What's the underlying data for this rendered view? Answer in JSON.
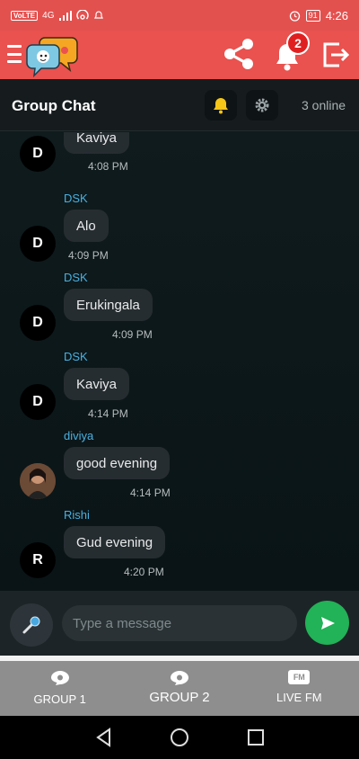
{
  "status_bar": {
    "volte": "VoLTE",
    "network": "4G",
    "battery": "91",
    "time": "4:26"
  },
  "header": {
    "notification_count": "2",
    "brand_color": "#e9524f"
  },
  "chat": {
    "title": "Group Chat",
    "online": "3 online"
  },
  "messages": [
    {
      "sender": "",
      "avatar": "D",
      "text": "Kaviya",
      "time": "4:08 PM"
    },
    {
      "sender": "DSK",
      "avatar": "D",
      "text": "Alo",
      "time": "4:09 PM"
    },
    {
      "sender": "DSK",
      "avatar": "D",
      "text": "Erukingala",
      "time": "4:09 PM"
    },
    {
      "sender": "DSK",
      "avatar": "D",
      "text": "Kaviya",
      "time": "4:14 PM"
    },
    {
      "sender": "diviya",
      "avatar": "photo",
      "text": "good evening",
      "time": "4:14 PM"
    },
    {
      "sender": "Rishi",
      "avatar": "R",
      "text": "Gud evening",
      "time": "4:20 PM"
    }
  ],
  "composer": {
    "placeholder": "Type a message"
  },
  "tabs": [
    {
      "label": "GROUP 1",
      "icon": "chat-bubble-icon",
      "active": false
    },
    {
      "label": "GROUP 2",
      "icon": "chat-bubble-icon",
      "active": true
    },
    {
      "label": "LIVE FM",
      "icon": "fm-icon",
      "badge": "FM",
      "active": false
    }
  ]
}
